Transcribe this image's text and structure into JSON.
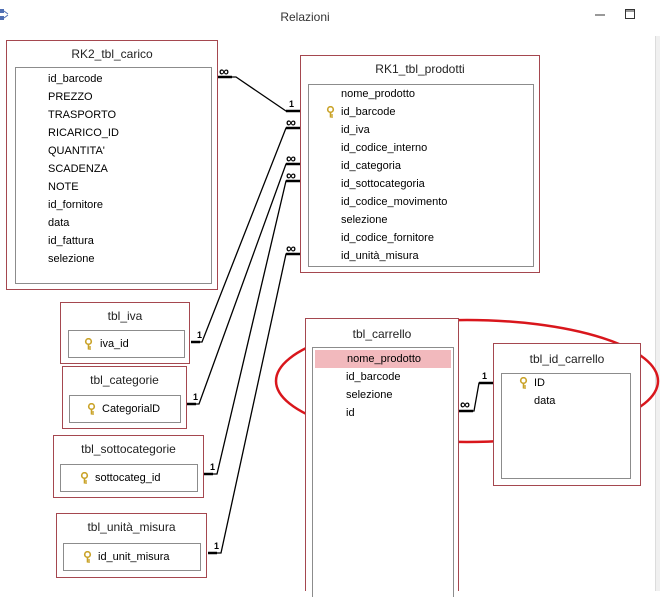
{
  "window": {
    "title": "Relazioni"
  },
  "tables": {
    "rk2_tbl_carico": {
      "title": "RK2_tbl_carico",
      "fields": [
        "id_barcode",
        "PREZZO",
        "TRASPORTO",
        "RICARICO_ID",
        "QUANTITA'",
        "SCADENZA",
        "NOTE",
        "id_fornitore",
        "data",
        "id_fattura",
        "selezione"
      ]
    },
    "rk1_tbl_prodotti": {
      "title": "RK1_tbl_prodotti",
      "fields": [
        "nome_prodotto",
        "id_barcode",
        "id_iva",
        "id_codice_interno",
        "id_categoria",
        "id_sottocategoria",
        "id_codice_movimento",
        "selezione",
        "id_codice_fornitore",
        "id_unità_misura"
      ]
    },
    "tbl_iva": {
      "title": "tbl_iva",
      "fields": [
        "iva_id"
      ]
    },
    "tbl_categorie": {
      "title": "tbl_categorie",
      "fields": [
        "CategorialD"
      ]
    },
    "tbl_sottocategorie": {
      "title": "tbl_sottocategorie",
      "fields": [
        "sottocateg_id"
      ]
    },
    "tbl_unita_misura": {
      "title": "tbl_unità_misura",
      "fields": [
        "id_unit_misura"
      ]
    },
    "tbl_carrello": {
      "title": "tbl_carrello",
      "fields": [
        "nome_prodotto",
        "id_barcode",
        "selezione",
        "id"
      ]
    },
    "tbl_id_carrello": {
      "title": "tbl_id_carrello",
      "fields": [
        "ID",
        "data"
      ]
    }
  },
  "symbols": {
    "one": "1",
    "many": "∞"
  },
  "colors": {
    "table_border": "#a5474f",
    "selection": "#f2b9bd",
    "annotation": "#d9161c",
    "key": "#c9a227"
  },
  "icons": {
    "key": "key-icon",
    "minimize": "minimize-icon",
    "maximize": "maximize-icon",
    "app": "app-icon"
  }
}
